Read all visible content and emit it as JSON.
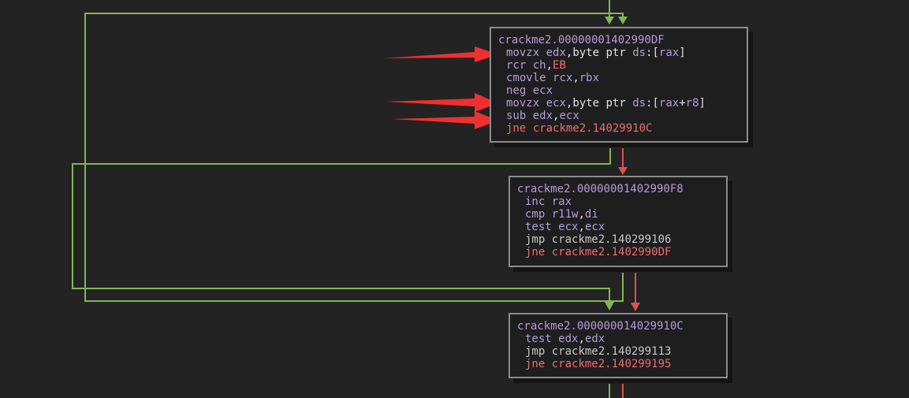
{
  "blocks": [
    {
      "id": "block-1",
      "label": "crackme2.00000001402990DF",
      "lines": [
        {
          "mnemonic": "movzx",
          "tokens": [
            [
              "edx",
              "reg"
            ],
            [
              ",",
              ""
            ],
            [
              "byte ptr ",
              "word"
            ],
            [
              "ds",
              "seg"
            ],
            [
              ":[",
              ""
            ],
            [
              "rax",
              "reg"
            ],
            [
              "]",
              ""
            ]
          ]
        },
        {
          "mnemonic": "rcr",
          "tokens": [
            [
              "ch",
              "reg"
            ],
            [
              ",",
              ""
            ],
            [
              "EB",
              "imm"
            ]
          ]
        },
        {
          "mnemonic": "cmovle",
          "tokens": [
            [
              "rcx",
              "reg"
            ],
            [
              ",",
              ""
            ],
            [
              "rbx",
              "reg"
            ]
          ]
        },
        {
          "mnemonic": "neg",
          "tokens": [
            [
              "ecx",
              "reg"
            ]
          ]
        },
        {
          "mnemonic": "movzx",
          "tokens": [
            [
              "ecx",
              "reg"
            ],
            [
              ",",
              ""
            ],
            [
              "byte ptr ",
              "word"
            ],
            [
              "ds",
              "seg"
            ],
            [
              ":[",
              ""
            ],
            [
              "rax",
              "reg"
            ],
            [
              "+",
              ""
            ],
            [
              "r8",
              "reg"
            ],
            [
              "]",
              ""
            ]
          ]
        },
        {
          "mnemonic": "sub",
          "tokens": [
            [
              "edx",
              "reg"
            ],
            [
              ",",
              ""
            ],
            [
              "ecx",
              "reg"
            ]
          ]
        },
        {
          "mnemonic": "jne",
          "kind": "jcc",
          "tokens": [
            [
              "crackme2.14029910C",
              "addr-red"
            ]
          ]
        }
      ]
    },
    {
      "id": "block-2",
      "label": "crackme2.00000001402990F8",
      "lines": [
        {
          "mnemonic": "inc",
          "tokens": [
            [
              "rax",
              "reg"
            ]
          ]
        },
        {
          "mnemonic": "cmp",
          "tokens": [
            [
              "r11w",
              "reg"
            ],
            [
              ",",
              ""
            ],
            [
              "di",
              "reg"
            ]
          ]
        },
        {
          "mnemonic": "test",
          "tokens": [
            [
              "ecx",
              "reg"
            ],
            [
              ",",
              ""
            ],
            [
              "ecx",
              "reg"
            ]
          ]
        },
        {
          "mnemonic": "jmp",
          "kind": "jmp",
          "tokens": [
            [
              "crackme2.140299106",
              "addr"
            ]
          ]
        },
        {
          "mnemonic": "jne",
          "kind": "jcc",
          "tokens": [
            [
              "crackme2.1402990DF",
              "addr-red"
            ]
          ]
        }
      ]
    },
    {
      "id": "block-3",
      "label": "crackme2.000000014029910C",
      "lines": [
        {
          "mnemonic": "test",
          "tokens": [
            [
              "edx",
              "reg"
            ],
            [
              ",",
              ""
            ],
            [
              "edx",
              "reg"
            ]
          ]
        },
        {
          "mnemonic": "jmp",
          "kind": "jmp",
          "tokens": [
            [
              "crackme2.140299113",
              "addr"
            ]
          ]
        },
        {
          "mnemonic": "jne",
          "kind": "jcc",
          "tokens": [
            [
              "crackme2.140299195",
              "addr-red"
            ]
          ]
        }
      ]
    }
  ],
  "colors": {
    "background": "#232323",
    "block_bg": "#1e1e1e",
    "block_border": "#8c8c8c",
    "edge_true": "#7fb755",
    "edge_false": "#e05050",
    "annotation_arrow": "#f03030"
  }
}
